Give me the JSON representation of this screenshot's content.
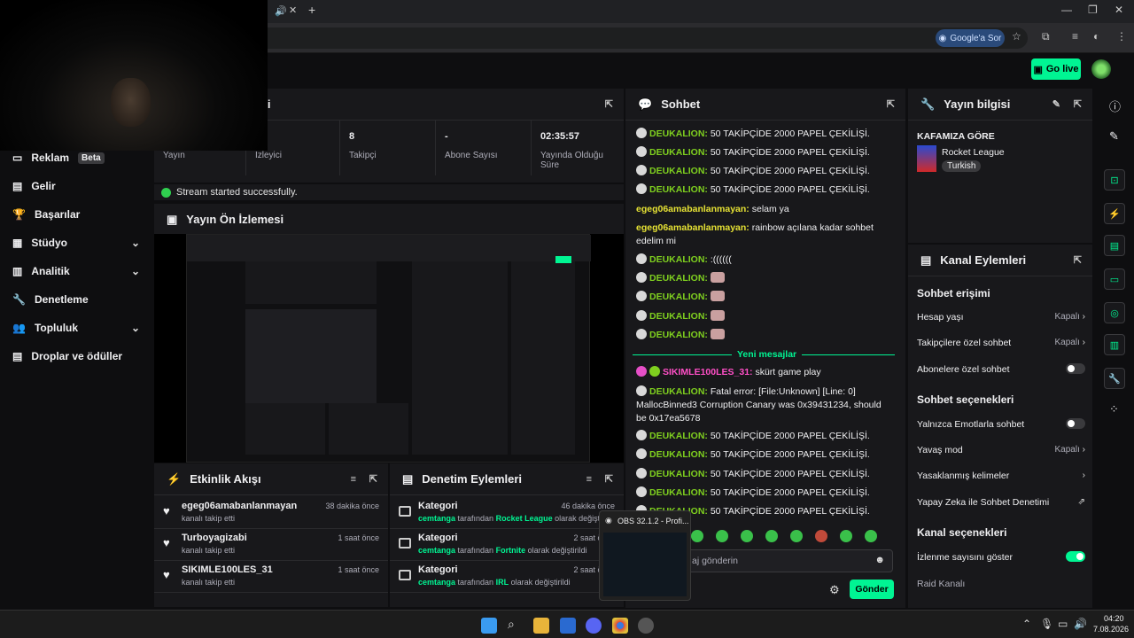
{
  "browser": {
    "google_button": "Google'a Sor",
    "new_tab": "+"
  },
  "topnav": {
    "go_live": "Go live"
  },
  "sidebar": {
    "items": [
      {
        "label": "Reklam",
        "badge": "Beta",
        "icon": "megaphone-icon"
      },
      {
        "label": "Gelir",
        "icon": "dollar-icon"
      },
      {
        "label": "Başarılar",
        "icon": "trophy-icon"
      },
      {
        "label": "Stüdyo",
        "icon": "studio-icon"
      },
      {
        "label": "Analitik",
        "icon": "chart-icon"
      },
      {
        "label": "Denetleme",
        "icon": "wrench-icon"
      },
      {
        "label": "Topluluk",
        "icon": "people-icon"
      },
      {
        "label": "Droplar ve ödüller",
        "icon": "gift-icon"
      }
    ]
  },
  "stats": {
    "title_tail": "leri",
    "cells": [
      {
        "value": "",
        "label": "Yayın"
      },
      {
        "value": "",
        "label": "İzleyici"
      },
      {
        "value": "8",
        "label": "Takipçi"
      },
      {
        "value": "-",
        "label": "Abone Sayısı"
      },
      {
        "value": "02:35:57",
        "label": "Yayında Olduğu Süre"
      }
    ],
    "success": "Stream started successfully."
  },
  "preview": {
    "title": "Yayın Ön İzlemesi"
  },
  "activity": {
    "title": "Etkinlik Akışı",
    "rows": [
      {
        "name": "egeg06amabanlanmayan",
        "sub": "kanalı takip etti",
        "time": "38 dakika önce"
      },
      {
        "name": "Turboyagizabi",
        "sub": "kanalı takip etti",
        "time": "1 saat önce"
      },
      {
        "name": "SIKIMLE100LES_31",
        "sub": "kanalı takip etti",
        "time": "1 saat önce"
      }
    ]
  },
  "mod": {
    "title": "Denetim Eylemleri",
    "rows": [
      {
        "name": "Kategori",
        "actor": "cemtanga",
        "mid": " tarafından ",
        "game": "Rocket League",
        "end": " olarak değiştirildi",
        "time": "46 dakika önce"
      },
      {
        "name": "Kategori",
        "actor": "cemtanga",
        "mid": " tarafından ",
        "game": "Fortnite",
        "end": " olarak değiştirildi",
        "time": "2 saat önce"
      },
      {
        "name": "Kategori",
        "actor": "cemtanga",
        "mid": " tarafından ",
        "game": "IRL",
        "end": " olarak değiştirildi",
        "time": "2 saat önce"
      }
    ]
  },
  "chat": {
    "title": "Sohbet",
    "messages": [
      {
        "user": "DEUKALION:",
        "text": " 50 TAKİPÇİDE 2000 PAPEL ÇEKİLİŞİ."
      },
      {
        "user": "DEUKALION:",
        "text": " 50 TAKİPÇİDE 2000 PAPEL ÇEKİLİŞİ."
      },
      {
        "user": "DEUKALION:",
        "text": " 50 TAKİPÇİDE 2000 PAPEL ÇEKİLİŞİ."
      },
      {
        "user": "DEUKALION:",
        "text": " 50 TAKİPÇİDE 2000 PAPEL ÇEKİLİŞİ."
      },
      {
        "user": "egeg06amabanlanmayan:",
        "text": " selam ya"
      },
      {
        "user": "egeg06amabanlanmayan:",
        "text": " rainbow açılana kadar sohbet edelim mi"
      },
      {
        "user": "DEUKALION:",
        "text": " :(((((("
      },
      {
        "user": "DEUKALION:",
        "text": ""
      },
      {
        "user": "DEUKALION:",
        "text": ""
      },
      {
        "user": "DEUKALION:",
        "text": ""
      },
      {
        "user": "DEUKALION:",
        "text": ""
      }
    ],
    "divider": "Yeni mesajlar",
    "new_messages": [
      {
        "user": "SIKIMLE100LES_31:",
        "text": " skürt game play"
      },
      {
        "user": "DEUKALION:",
        "text": " Fatal error: [File:Unknown] [Line: 0] MallocBinned3 Corruption Canary was 0x39431234, should be 0x17ea5678"
      },
      {
        "user": "DEUKALION:",
        "text": " 50 TAKİPÇİDE 2000 PAPEL ÇEKİLİŞİ."
      },
      {
        "user": "DEUKALION:",
        "text": " 50 TAKİPÇİDE 2000 PAPEL ÇEKİLİŞİ."
      },
      {
        "user": "DEUKALION:",
        "text": " 50 TAKİPÇİDE 2000 PAPEL ÇEKİLİŞİ."
      },
      {
        "user": "DEUKALION:",
        "text": " 50 TAKİPÇİDE 2000 PAPEL ÇEKİLİŞİ."
      },
      {
        "user": "DEUKALION:",
        "text": " 50 TAKİPÇİDE 2000 PAPEL ÇEKİLİŞİ."
      }
    ],
    "input_placeholder": "aj gönderin",
    "send": "Gönder"
  },
  "info": {
    "title": "Yayın bilgisi",
    "stream_title": "KAFAMIZA GÖRE",
    "game": "Rocket League",
    "tag": "Turkish"
  },
  "actions": {
    "title": "Kanal Eylemleri",
    "sec1": "Sohbet erişimi",
    "r1": "Hesap yaşı",
    "r1v": "Kapalı",
    "r2": "Takipçilere özel sohbet",
    "r2v": "Kapalı",
    "r3": "Abonelere özel sohbet",
    "sec2": "Sohbet seçenekleri",
    "r4": "Yalnızca Emotlarla sohbet",
    "r5": "Yavaş mod",
    "r5v": "Kapalı",
    "r6": "Yasaklanmış kelimeler",
    "r7": "Yapay Zeka ile Sohbet Denetimi",
    "sec3": "Kanal seçenekleri",
    "r8": "İzlenme sayısını göster",
    "r9": "Raid Kanalı"
  },
  "obs_popup": {
    "title": "OBS 32.1.2 - Profi..."
  },
  "taskbar": {
    "time": "04:20",
    "date": "7.08.2026"
  }
}
